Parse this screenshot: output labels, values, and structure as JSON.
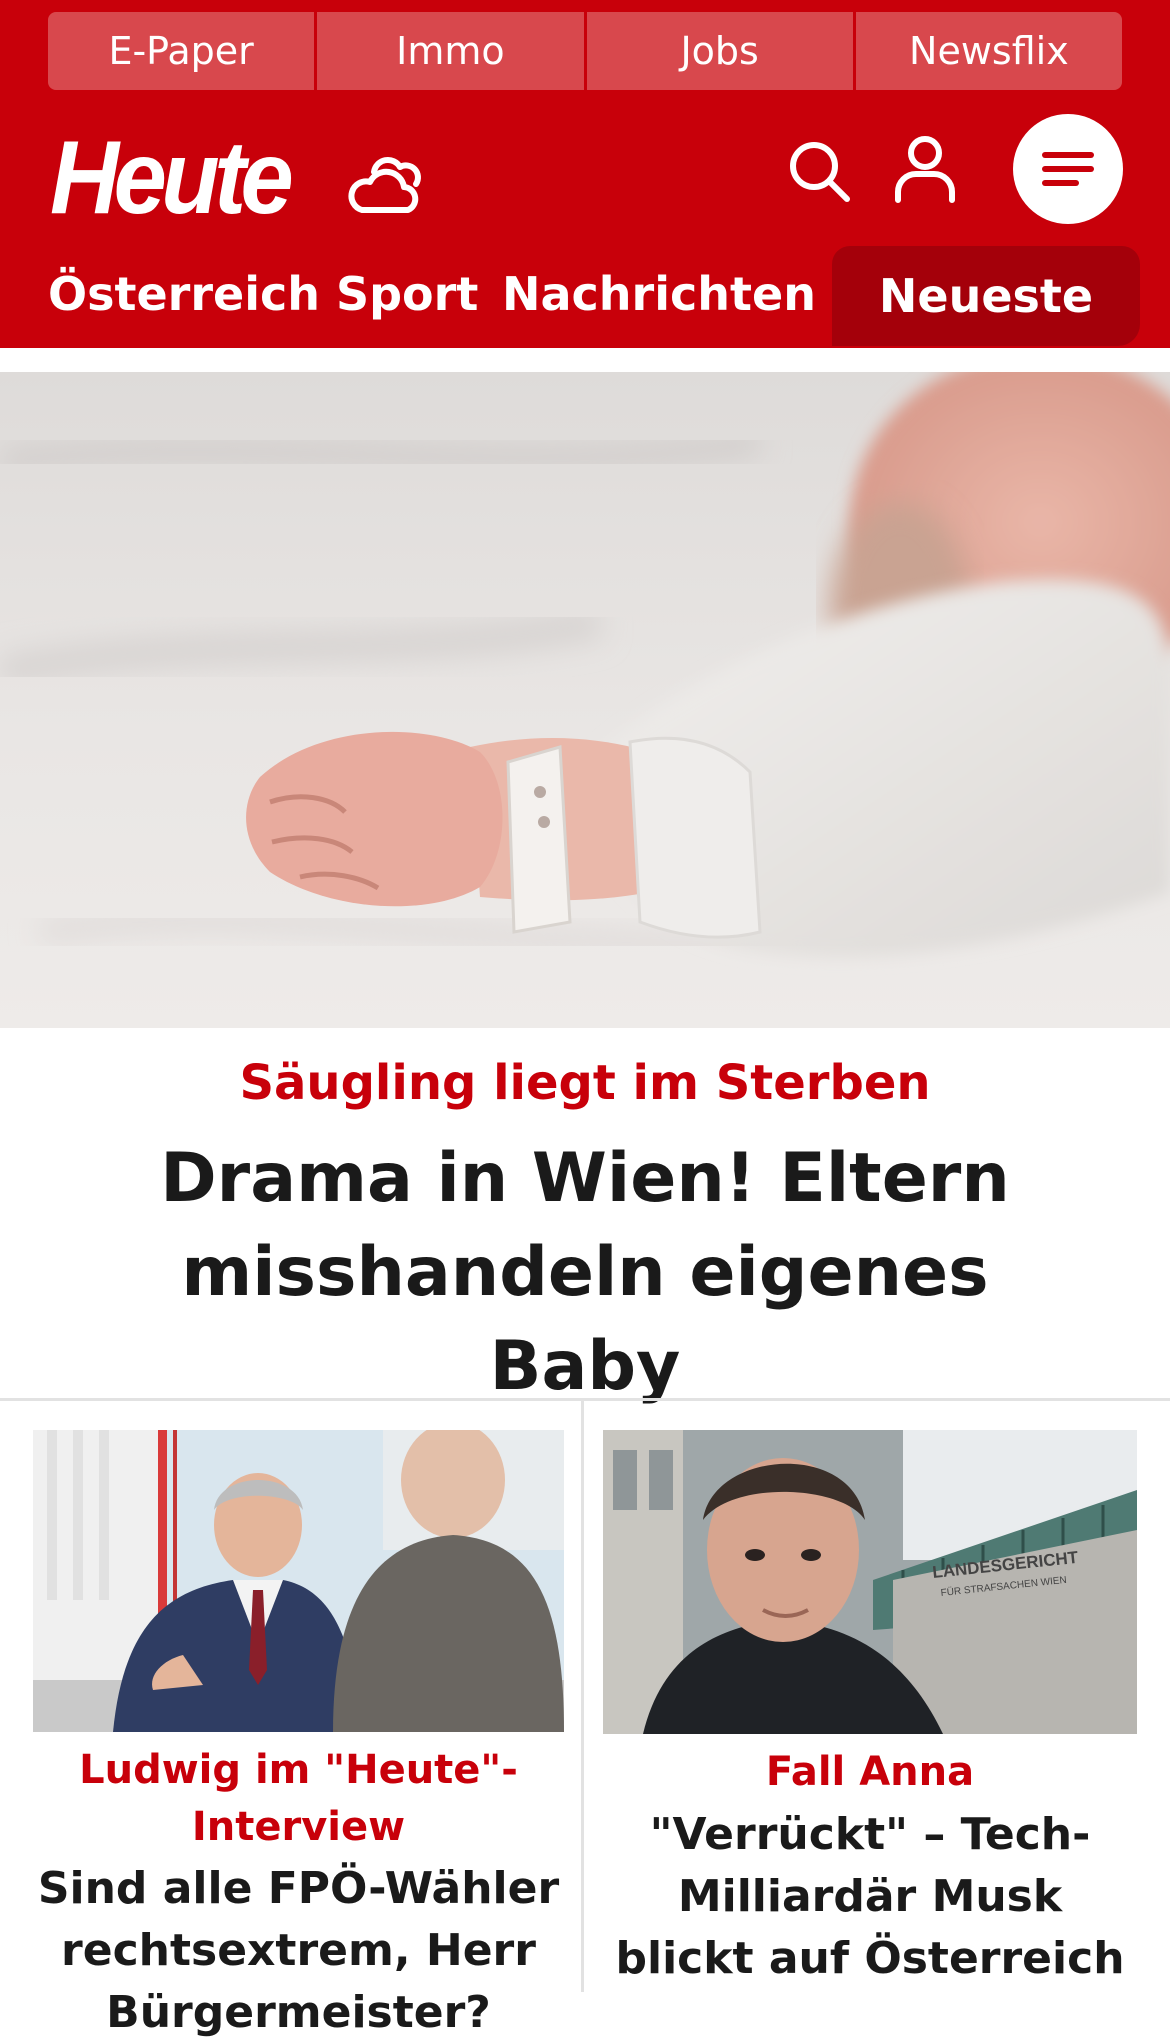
{
  "service_bar": {
    "items": [
      {
        "label": "E-Paper"
      },
      {
        "label": "Immo"
      },
      {
        "label": "Jobs"
      },
      {
        "label": "Newsflix"
      }
    ]
  },
  "header": {
    "logo_text": "Heute",
    "icons": {
      "weather": "weather-cloud-icon",
      "search": "search-icon",
      "account": "user-icon",
      "menu": "hamburger-menu-icon"
    }
  },
  "nav": {
    "items": [
      {
        "label": "Österreich"
      },
      {
        "label": "Sport"
      },
      {
        "label": "Nachrichten"
      }
    ],
    "latest_label": "Neueste"
  },
  "hero": {
    "kicker": "Säugling liegt im Sterben",
    "title": "Drama in Wien! Eltern misshandeln eigenes Baby"
  },
  "teasers": [
    {
      "kicker": "Ludwig im \"Heute\"-Interview",
      "title": "Sind alle FPÖ-Wähler rechtsextrem, Herr Bürgermeister?"
    },
    {
      "kicker": "Fall Anna",
      "title": "\"Verrückt\" – Tech-Milliardär Musk blickt auf Österreich"
    }
  ],
  "image_text": {
    "court_sign_line1": "LANDESGERICHT",
    "court_sign_line2": "FÜR STRAFSACHEN WIEN"
  },
  "colors": {
    "brand_red": "#c8000a",
    "service_item_bg": "#d8484d",
    "latest_tab_bg": "#a4000a",
    "kicker_red": "#c8000a",
    "title_text": "#1a1a1a",
    "divider": "#e2e2e2"
  }
}
